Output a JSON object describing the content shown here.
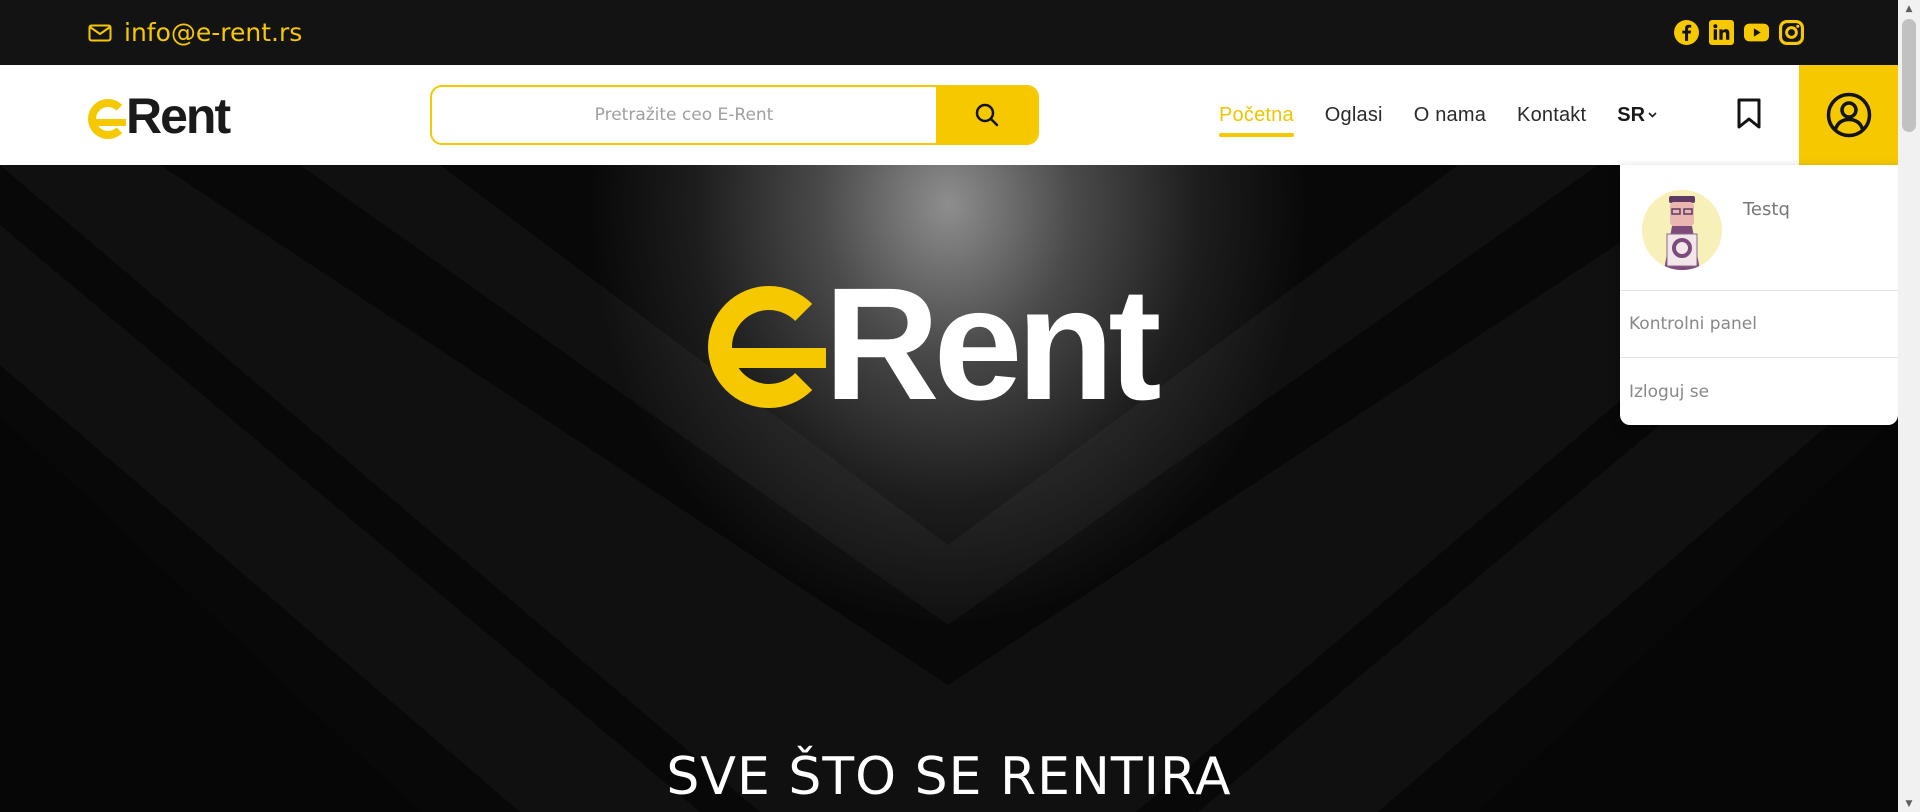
{
  "topbar": {
    "email": "info@e-rent.rs",
    "socials": [
      "facebook-icon",
      "linkedin-icon",
      "youtube-icon",
      "instagram-icon"
    ]
  },
  "header": {
    "logo_prefix": "e",
    "logo_word": "Rent",
    "search": {
      "placeholder": "Pretražite ceo E-Rent",
      "value": ""
    },
    "nav": [
      {
        "label": "Početna",
        "active": true
      },
      {
        "label": "Oglasi",
        "active": false
      },
      {
        "label": "O nama",
        "active": false
      },
      {
        "label": "Kontakt",
        "active": false
      }
    ],
    "language": "SR"
  },
  "hero": {
    "logo_prefix": "e",
    "logo_word": "Rent",
    "tagline": "SVE ŠTO SE RENTIRA"
  },
  "user_menu": {
    "username": "Testq",
    "items": [
      "Kontrolni panel",
      "Izloguj se"
    ]
  },
  "colors": {
    "accent": "#f5c800",
    "topbar_bg": "#131313",
    "header_bg": "#ffffff"
  }
}
